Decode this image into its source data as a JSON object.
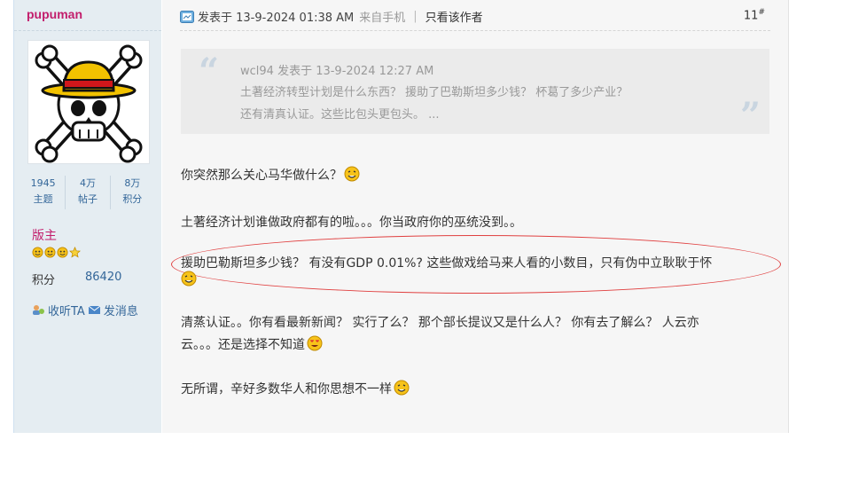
{
  "author": {
    "username": "pupuman",
    "stats": [
      {
        "value": "1945",
        "label": "主题"
      },
      {
        "value": "4万",
        "label": "帖子"
      },
      {
        "value": "8万",
        "label": "积分"
      }
    ],
    "rank": "版主",
    "credit_label": "积分",
    "credit_value": "86420",
    "follow_label": "收听TA",
    "message_label": "发消息"
  },
  "post": {
    "posted_text": "发表于 13-9-2024 01:38 AM",
    "source_text": "来自手机",
    "separator": "|",
    "only_author_label": "只看该作者",
    "floor": "11",
    "floor_mark": "#",
    "quote": {
      "head": "wcl94 发表于 13-9-2024 12:27 AM",
      "lines": [
        "土著经济转型计划是什么东西？ 援助了巴勒斯坦多少钱？ 杯葛了多少产业？",
        "还有清真认证。这些比包头更包头。 ..."
      ]
    },
    "paragraphs": [
      "你突然那么关心马华做什么？",
      "土著经济计划谁做政府都有的啦。。。你当政府你的巫统没到。。",
      "援助巴勒斯坦多少钱？ 有没有GDP 0.01%? 这些做戏给马来人看的小数目，只有伪中立耿耿于怀",
      "清蒸认证。。你有看最新新闻？ 实行了么？ 那个部长提议又是什么人？ 你有去了解么？ 人云亦",
      "云。。。还是选择不知道",
      "无所谓，辛好多数华人和你思想不一样"
    ]
  },
  "colors": {
    "username": "#c21e6c",
    "link": "#336699",
    "sidebar_bg": "#e5edf2",
    "post_bg": "#f6f6f6",
    "quote_bg": "#ebebeb",
    "annotation": "#e04040"
  },
  "icons": [
    "post-icon",
    "skull-avatar",
    "smiley-icon",
    "star-icon",
    "follow-icon",
    "message-icon",
    "grin-emoji",
    "heart-eyes-emoji"
  ]
}
